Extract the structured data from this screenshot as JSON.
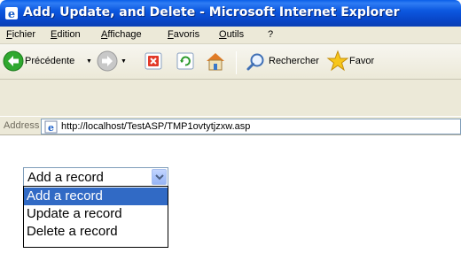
{
  "window": {
    "title": "Add, Update, and Delete - Microsoft Internet Explorer"
  },
  "menubar": {
    "items": [
      "Fichier",
      "Edition",
      "Affichage",
      "Favoris",
      "Outils",
      "?"
    ]
  },
  "toolbar": {
    "back_label": "Précédente",
    "search_label": "Rechercher",
    "favorites_label": "Favor"
  },
  "address": {
    "label": "Address",
    "url": "http://localhost/TestASP/TMP1ovtytjzxw.asp"
  },
  "form": {
    "select_value": "Add a record",
    "options": [
      "Add a record",
      "Update a record",
      "Delete a record"
    ],
    "highlighted_option": "Add a record"
  },
  "colors": {
    "titlebar": "#0a50d6",
    "highlight": "#316ac5",
    "chrome": "#ece9d8"
  }
}
